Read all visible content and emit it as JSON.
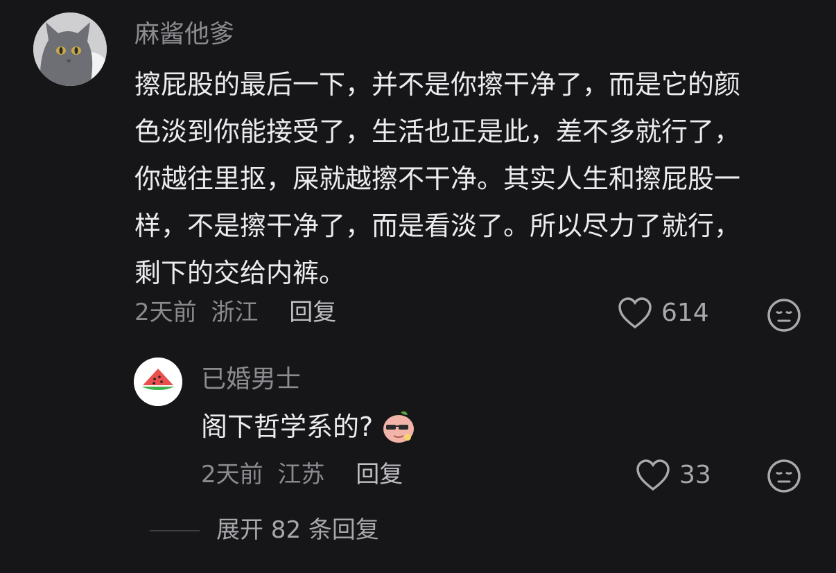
{
  "main_comment": {
    "username": "麻酱他爹",
    "lines": [
      "擦屁股的最后一下，并不是你擦干净了，而是它的颜",
      "色淡到你能接受了，生活也正是此，差不多就行了，",
      "你越往里抠，屎就越擦不干净。其实人生和擦屁股一",
      "样，不是擦干净了，而是看淡了。所以尽力了就行，",
      "剩下的交给内裤。"
    ],
    "time": "2天前",
    "location": "浙江",
    "reply_label": "回复",
    "likes": "614",
    "avatar_icon": "cat-avatar-icon"
  },
  "reply_comment": {
    "username": "已婚男士",
    "text": "阁下哲学系的?",
    "emoji_icon": "sunglasses-peach-emoji-icon",
    "time": "2天前",
    "location": "江苏",
    "reply_label": "回复",
    "likes": "33",
    "avatar_icon": "watermelon-avatar-icon"
  },
  "expand": {
    "label": "展开 82 条回复"
  },
  "colors": {
    "background": "#161618",
    "text": "#ececef",
    "muted": "#8a8a8f"
  }
}
